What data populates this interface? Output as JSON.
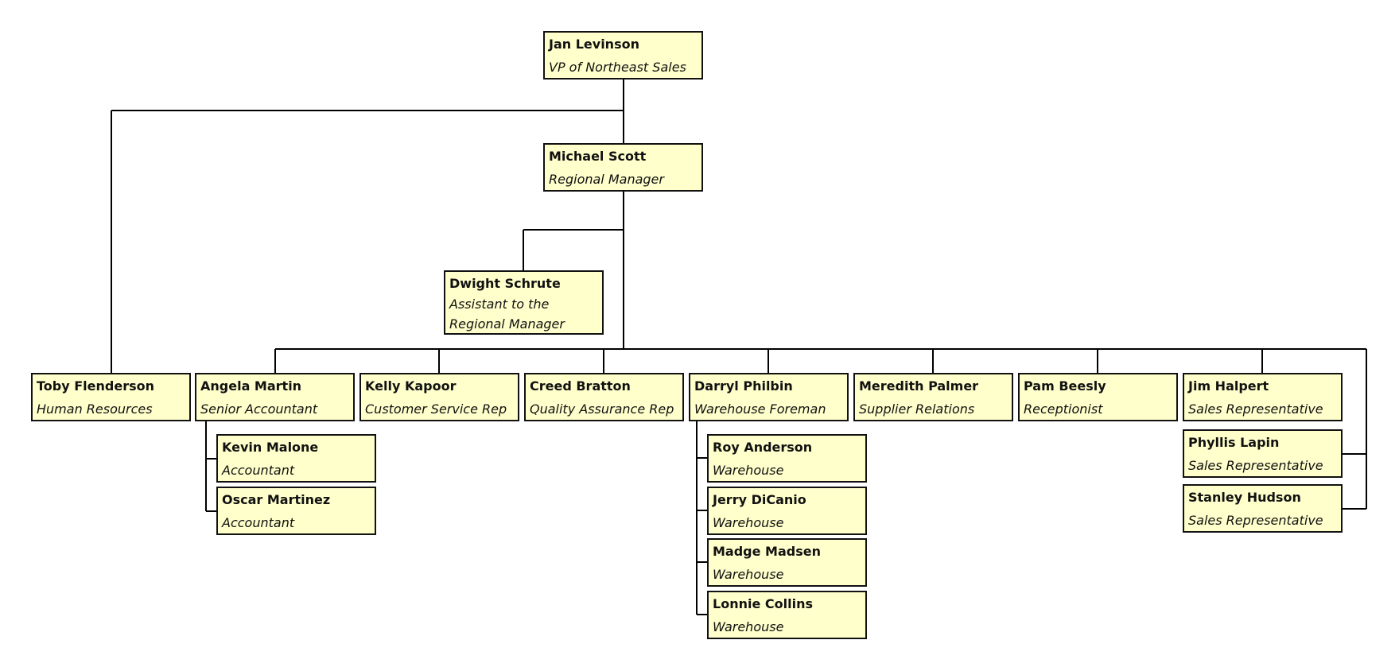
{
  "chart": {
    "title": "",
    "nodes": [
      {
        "id": "jan",
        "name": "Jan Levinson",
        "title": "VP of Northeast Sales",
        "parent": null
      },
      {
        "id": "michael",
        "name": "Michael Scott",
        "title": "Regional Manager",
        "parent": "jan"
      },
      {
        "id": "toby",
        "name": "Toby Flenderson",
        "title": "Human Resources",
        "parent": "jan"
      },
      {
        "id": "dwight",
        "name": "Dwight Schrute",
        "title": "Assistant to the Regional Manager",
        "parent": "michael"
      },
      {
        "id": "angela",
        "name": "Angela Martin",
        "title": "Senior Accountant",
        "parent": "michael"
      },
      {
        "id": "kelly",
        "name": "Kelly Kapoor",
        "title": "Customer Service Rep",
        "parent": "michael"
      },
      {
        "id": "creed",
        "name": "Creed Bratton",
        "title": "Quality Assurance Rep",
        "parent": "michael"
      },
      {
        "id": "darryl",
        "name": "Darryl Philbin",
        "title": "Warehouse Foreman",
        "parent": "michael"
      },
      {
        "id": "meredith",
        "name": "Meredith Palmer",
        "title": "Supplier Relations",
        "parent": "michael"
      },
      {
        "id": "pam",
        "name": "Pam Beesly",
        "title": "Receptionist",
        "parent": "michael"
      },
      {
        "id": "jim",
        "name": "Jim Halpert",
        "title": "Sales Representative",
        "parent": "michael"
      },
      {
        "id": "phyllis",
        "name": "Phyllis Lapin",
        "title": "Sales Representative",
        "parent": "michael"
      },
      {
        "id": "stanley",
        "name": "Stanley Hudson",
        "title": "Sales Representative",
        "parent": "michael"
      },
      {
        "id": "kevin",
        "name": "Kevin Malone",
        "title": "Accountant",
        "parent": "angela"
      },
      {
        "id": "oscar",
        "name": "Oscar Martinez",
        "title": "Accountant",
        "parent": "angela"
      },
      {
        "id": "roy",
        "name": "Roy Anderson",
        "title": "Warehouse",
        "parent": "darryl"
      },
      {
        "id": "jerry",
        "name": "Jerry DiCanio",
        "title": "Warehouse",
        "parent": "darryl"
      },
      {
        "id": "madge",
        "name": "Madge Madsen",
        "title": "Warehouse",
        "parent": "darryl"
      },
      {
        "id": "lonnie",
        "name": "Lonnie Collins",
        "title": "Warehouse",
        "parent": "darryl"
      }
    ]
  },
  "colors": {
    "box_fill": "#ffffcc",
    "box_border": "#111111",
    "line": "#000000"
  }
}
